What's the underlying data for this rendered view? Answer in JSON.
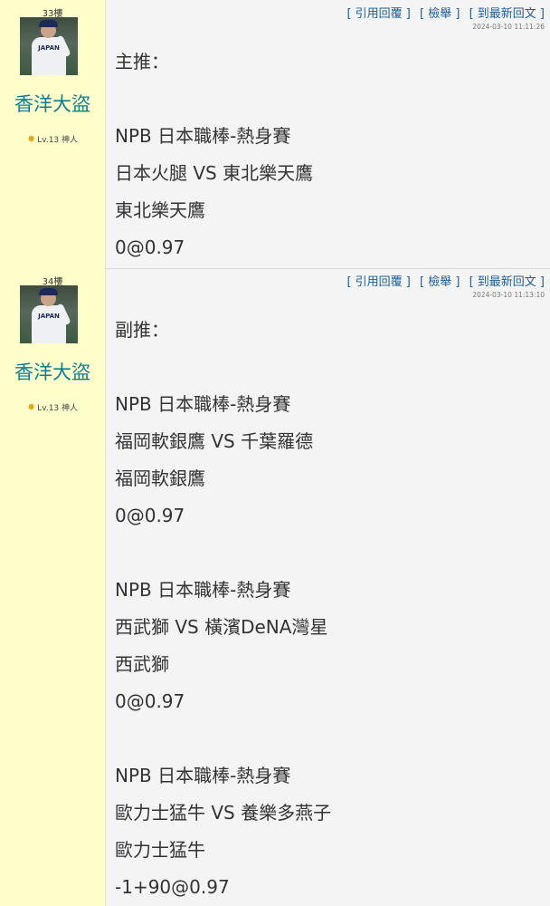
{
  "posts": [
    {
      "floor": "33樓",
      "username": "香洋大盜",
      "level": "Lv.13 神人",
      "actions": [
        "[ 引用回覆 ]",
        "[ 檢舉 ]",
        "[ 到最新回文 ]"
      ],
      "timestamp": "2024-03-10 11:11:26",
      "lines": [
        "主推：",
        "",
        "NPB 日本職棒-熱身賽",
        "日本火腿 VS 東北樂天鷹",
        "東北樂天鷹",
        "0@0.97"
      ]
    },
    {
      "floor": "34樓",
      "username": "香洋大盜",
      "level": "Lv.13 神人",
      "actions": [
        "[ 引用回覆 ]",
        "[ 檢舉 ]",
        "[ 到最新回文 ]"
      ],
      "timestamp": "2024-03-10 11:13:10",
      "lines": [
        "副推：",
        "",
        "NPB 日本職棒-熱身賽",
        "福岡軟銀鷹 VS 千葉羅德",
        "福岡軟銀鷹",
        "0@0.97",
        "",
        "NPB 日本職棒-熱身賽",
        "西武獅 VS 橫濱DeNA灣星",
        "西武獅",
        "0@0.97",
        "",
        "NPB 日本職棒-熱身賽",
        "歐力士猛牛 VS 養樂多燕子",
        "歐力士猛牛",
        "-1+90@0.97"
      ]
    }
  ],
  "avatar_jersey": "JAPAN",
  "colors": {
    "sidebar": "#ffffcc",
    "username": "#0e7c92",
    "link": "#1a5e9a"
  }
}
